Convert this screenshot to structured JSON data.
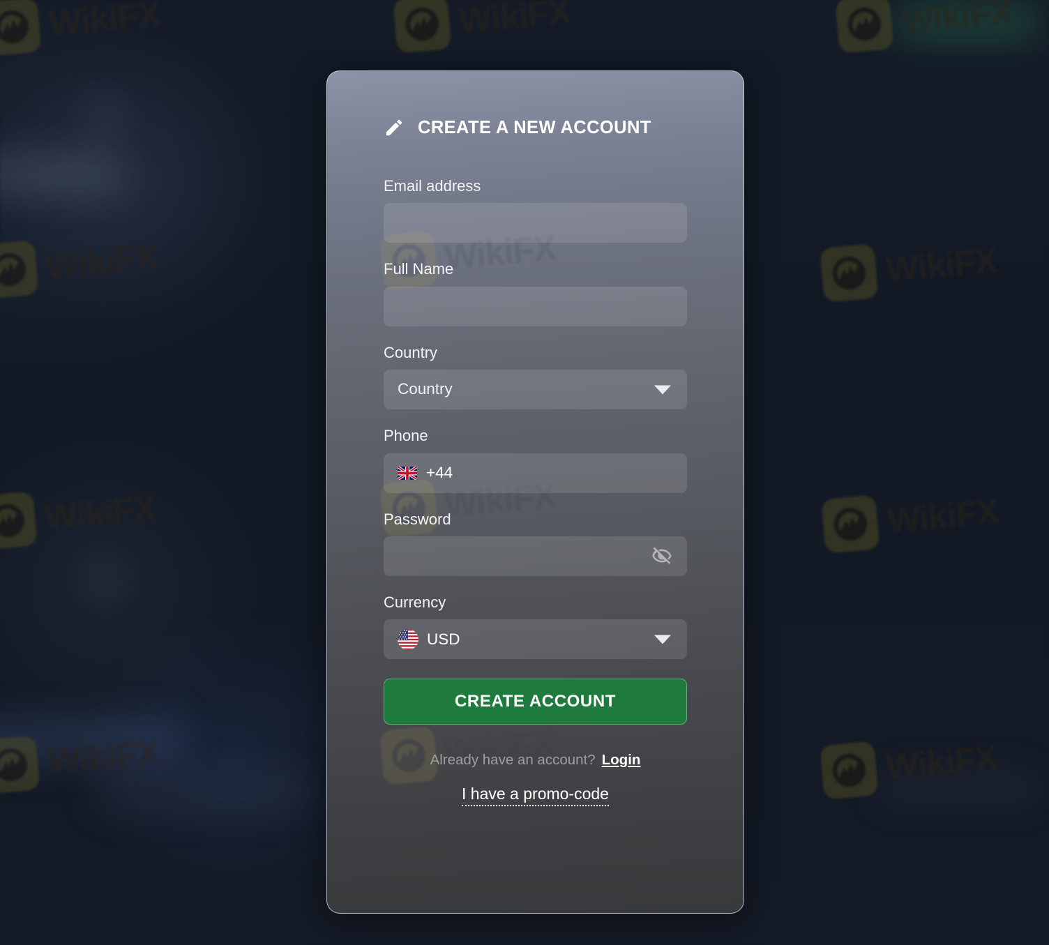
{
  "background": {
    "watermark_text": "WikiFX",
    "watermark_logo_icon": "wikifx-eagle-logo-icon",
    "page_bg_color": "#131a26"
  },
  "card": {
    "title": "CREATE A NEW ACCOUNT",
    "title_icon": "pencil-icon",
    "accent_color": "#1f7a3d",
    "fields": {
      "email": {
        "label": "Email address",
        "value": "",
        "placeholder": ""
      },
      "full_name": {
        "label": "Full Name",
        "value": "",
        "placeholder": ""
      },
      "country": {
        "label": "Country",
        "value": "Country",
        "caret_icon": "chevron-down-icon"
      },
      "phone": {
        "label": "Phone",
        "value": "+44",
        "flag_icon": "flag-uk-icon"
      },
      "password": {
        "label": "Password",
        "value": "",
        "toggle_icon": "eye-off-icon"
      },
      "currency": {
        "label": "Currency",
        "value": "USD",
        "flag_icon": "flag-us-icon",
        "caret_icon": "chevron-down-icon"
      }
    },
    "submit_label": "CREATE ACCOUNT",
    "login_prompt": "Already have an account?",
    "login_label": "Login",
    "promo_label": "I have a promo-code"
  }
}
